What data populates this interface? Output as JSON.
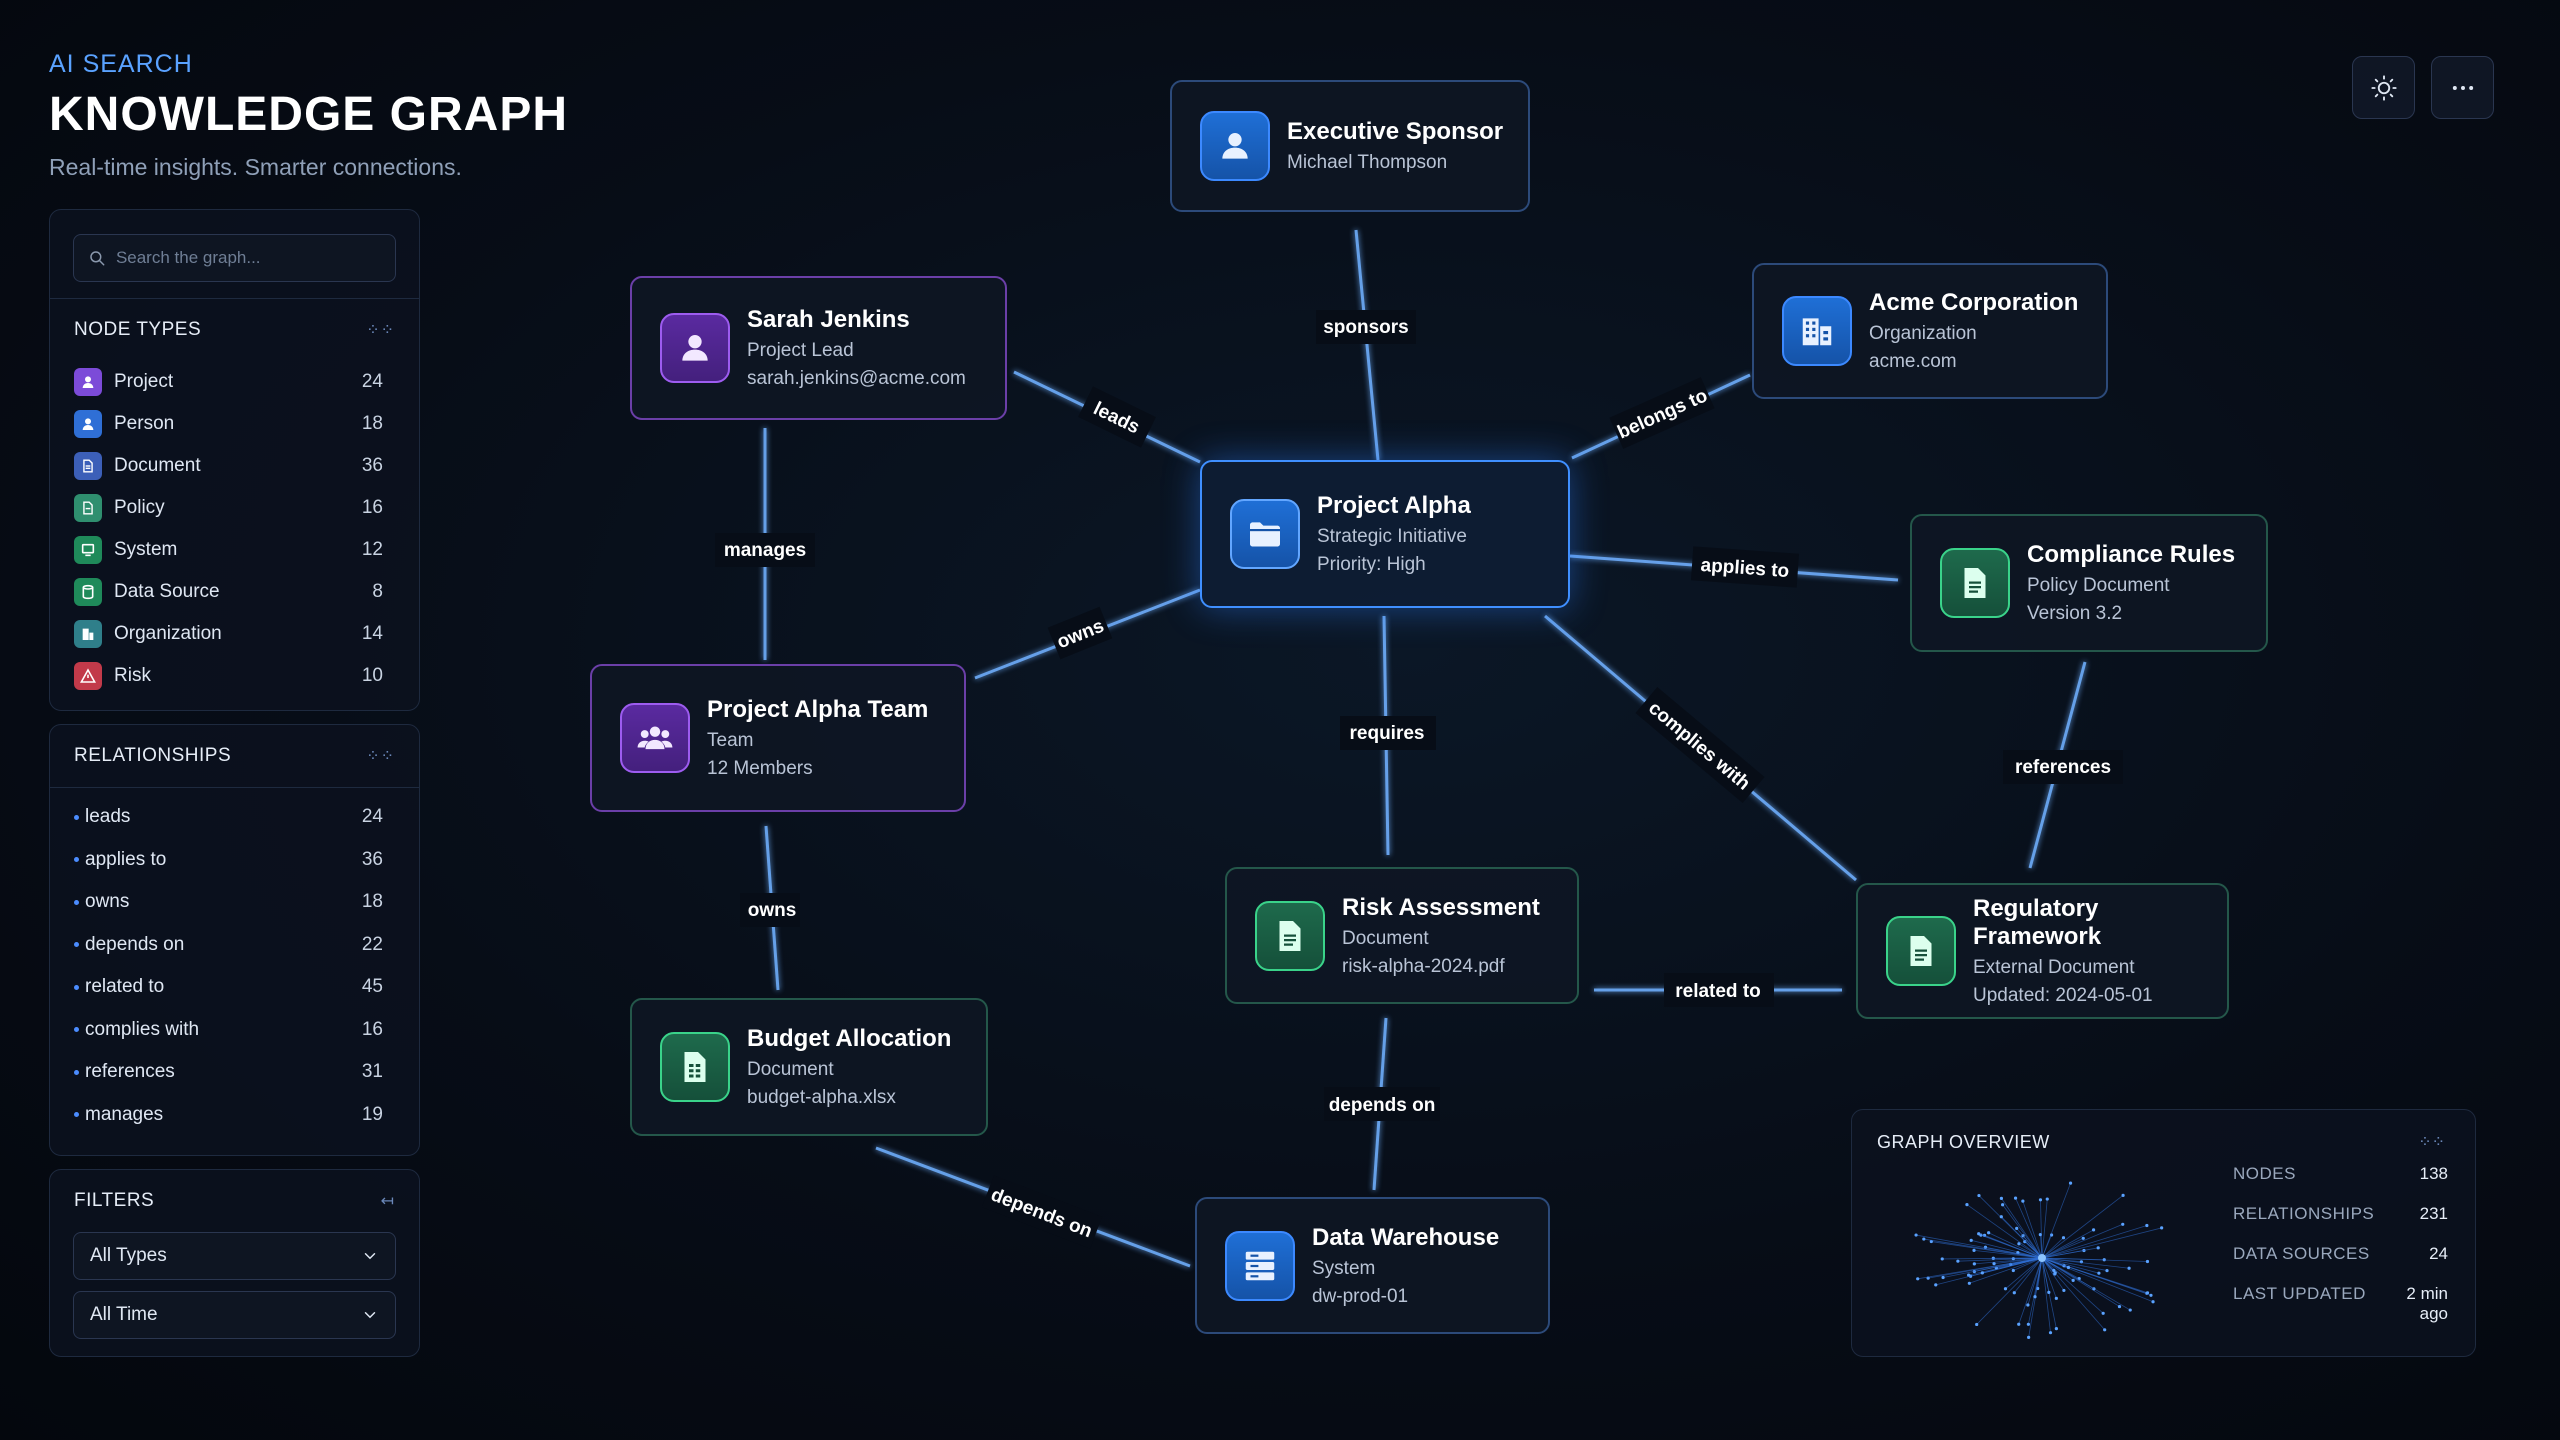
{
  "header": {
    "eyebrow": "AI SEARCH",
    "title": "KNOWLEDGE GRAPH",
    "subtitle": "Real-time insights. Smarter connections."
  },
  "toolbar": {
    "theme_icon": "sun-icon",
    "more_icon": "more-horizontal-icon"
  },
  "search": {
    "placeholder": "Search the graph..."
  },
  "node_types": {
    "title": "NODE TYPES",
    "items": [
      {
        "label": "Project",
        "count": "24",
        "icon": "person-icon",
        "color": "#7c4bd8"
      },
      {
        "label": "Person",
        "count": "18",
        "icon": "person-icon",
        "color": "#2f6fd6"
      },
      {
        "label": "Document",
        "count": "36",
        "icon": "document-icon",
        "color": "#3c5fb8"
      },
      {
        "label": "Policy",
        "count": "16",
        "icon": "policy-icon",
        "color": "#2f8f6f"
      },
      {
        "label": "System",
        "count": "12",
        "icon": "system-icon",
        "color": "#1f8a5a"
      },
      {
        "label": "Data Source",
        "count": "8",
        "icon": "database-icon",
        "color": "#1f8a5a"
      },
      {
        "label": "Organization",
        "count": "14",
        "icon": "building-icon",
        "color": "#2f7f8a"
      },
      {
        "label": "Risk",
        "count": "10",
        "icon": "warning-icon",
        "color": "#c23a4a"
      }
    ]
  },
  "relationships": {
    "title": "RELATIONSHIPS",
    "items": [
      {
        "label": "leads",
        "count": "24"
      },
      {
        "label": "applies to",
        "count": "36"
      },
      {
        "label": "owns",
        "count": "18"
      },
      {
        "label": "depends on",
        "count": "22"
      },
      {
        "label": "related to",
        "count": "45"
      },
      {
        "label": "complies with",
        "count": "16"
      },
      {
        "label": "references",
        "count": "31"
      },
      {
        "label": "manages",
        "count": "19"
      }
    ]
  },
  "filters": {
    "title": "FILTERS",
    "type_value": "All Types",
    "time_value": "All Time"
  },
  "nodes": {
    "executive_sponsor": {
      "title": "Executive Sponsor",
      "line1": "Michael Thompson",
      "icon": "person-icon"
    },
    "sarah": {
      "title": "Sarah Jenkins",
      "line1": "Project Lead",
      "line2": "sarah.jenkins@acme.com",
      "icon": "person-icon"
    },
    "acme": {
      "title": "Acme Corporation",
      "line1": "Organization",
      "line2": "acme.com",
      "icon": "building-icon"
    },
    "project_alpha": {
      "title": "Project Alpha",
      "line1": "Strategic Initiative",
      "line2": "Priority: High",
      "icon": "folder-icon"
    },
    "compliance": {
      "title": "Compliance Rules",
      "line1": "Policy Document",
      "line2": "Version 3.2",
      "icon": "document-icon"
    },
    "team": {
      "title": "Project Alpha Team",
      "line1": "Team",
      "line2": "12 Members",
      "icon": "group-icon"
    },
    "risk": {
      "title": "Risk Assessment",
      "line1": "Document",
      "line2": "risk-alpha-2024.pdf",
      "icon": "document-icon"
    },
    "regulatory": {
      "title": "Regulatory Framework",
      "line1": "External Document",
      "line2": "Updated: 2024-05-01",
      "icon": "document-icon"
    },
    "budget": {
      "title": "Budget Allocation",
      "line1": "Document",
      "line2": "budget-alpha.xlsx",
      "icon": "spreadsheet-icon"
    },
    "warehouse": {
      "title": "Data Warehouse",
      "line1": "System",
      "line2": "dw-prod-01",
      "icon": "server-icon"
    }
  },
  "edges": {
    "sponsors": "sponsors",
    "leads": "leads",
    "belongs_to": "belongs to",
    "manages": "manages",
    "owns_team": "owns",
    "applies_to": "applies to",
    "requires": "requires",
    "complies_with": "complies with",
    "references": "references",
    "owns_budget": "owns",
    "related_to": "related to",
    "depends_on_risk": "depends on",
    "depends_on_budget": "depends on"
  },
  "overview": {
    "title": "GRAPH OVERVIEW",
    "stats": [
      {
        "label": "NODES",
        "value": "138"
      },
      {
        "label": "RELATIONSHIPS",
        "value": "231"
      },
      {
        "label": "DATA SOURCES",
        "value": "24"
      },
      {
        "label": "LAST UPDATED",
        "value": "2 min ago"
      }
    ]
  },
  "colors": {
    "accent": "#3c89ff",
    "edge": "#6fb0ff",
    "purple": "#9d5cf0",
    "green": "#3ad38a"
  }
}
